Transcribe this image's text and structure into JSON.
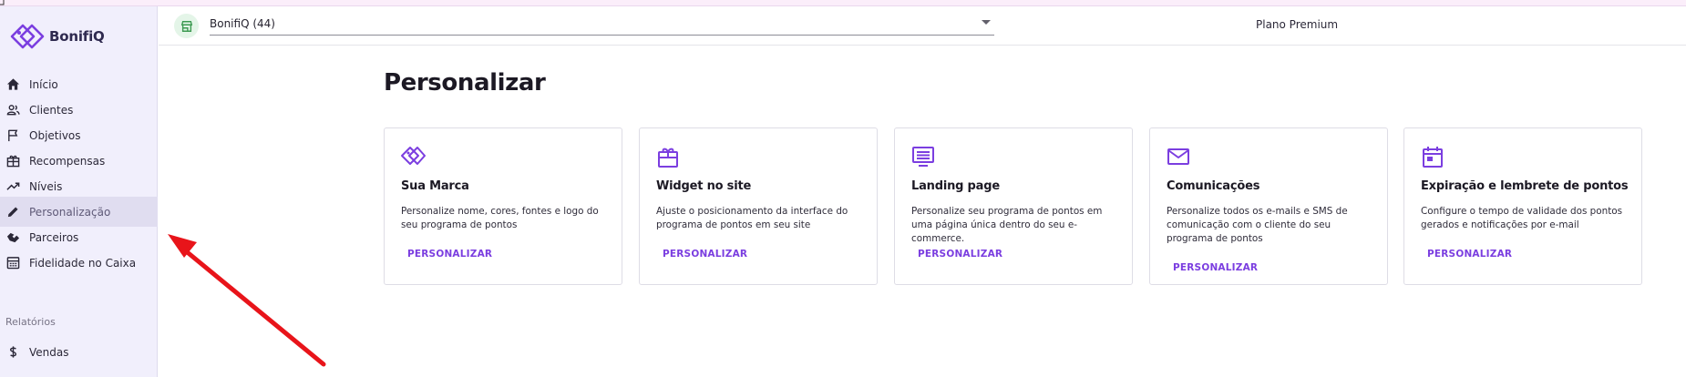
{
  "brand": {
    "name": "BonifiQ",
    "accent": "#7b3ee0"
  },
  "sidebar": {
    "items": [
      {
        "label": "Início",
        "icon": "home-icon"
      },
      {
        "label": "Clientes",
        "icon": "users-icon"
      },
      {
        "label": "Objetivos",
        "icon": "flag-icon"
      },
      {
        "label": "Recompensas",
        "icon": "gift-icon"
      },
      {
        "label": "Níveis",
        "icon": "trending-up-icon"
      },
      {
        "label": "Personalização",
        "icon": "pencil-icon",
        "active": true
      },
      {
        "label": "Parceiros",
        "icon": "handshake-icon"
      },
      {
        "label": "Fidelidade no Caixa",
        "icon": "cash-register-icon"
      }
    ],
    "section_label": "Relatórios",
    "report_items": [
      {
        "label": "Vendas",
        "icon": "dollar-icon"
      }
    ]
  },
  "topbar": {
    "store_select_value": "BonifiQ (44)",
    "plan": "Plano Premium"
  },
  "main": {
    "title": "Personalizar",
    "cards": [
      {
        "title": "Sua Marca",
        "description": "Personalize nome, cores, fontes e logo do seu programa de pontos",
        "button": "PERSONALIZAR",
        "icon": "brand-tag-icon"
      },
      {
        "title": "Widget no site",
        "description": "Ajuste o posicionamento da interface do programa de pontos em seu site",
        "button": "PERSONALIZAR",
        "icon": "widget-gift-icon"
      },
      {
        "title": "Landing page",
        "description": "Personalize seu programa de pontos em uma página única dentro do seu e-commerce.",
        "button": "PERSONALIZAR",
        "icon": "landing-page-icon"
      },
      {
        "title": "Comunicações",
        "description": "Personalize todos os e-mails e SMS de comunicação com o cliente do seu programa de pontos",
        "button": "PERSONALIZAR",
        "icon": "envelope-icon"
      },
      {
        "title": "Expiração e lembrete de pontos",
        "description": "Configure o tempo de validade dos pontos gerados e notificações por e-mail",
        "button": "PERSONALIZAR",
        "icon": "calendar-icon"
      }
    ]
  }
}
